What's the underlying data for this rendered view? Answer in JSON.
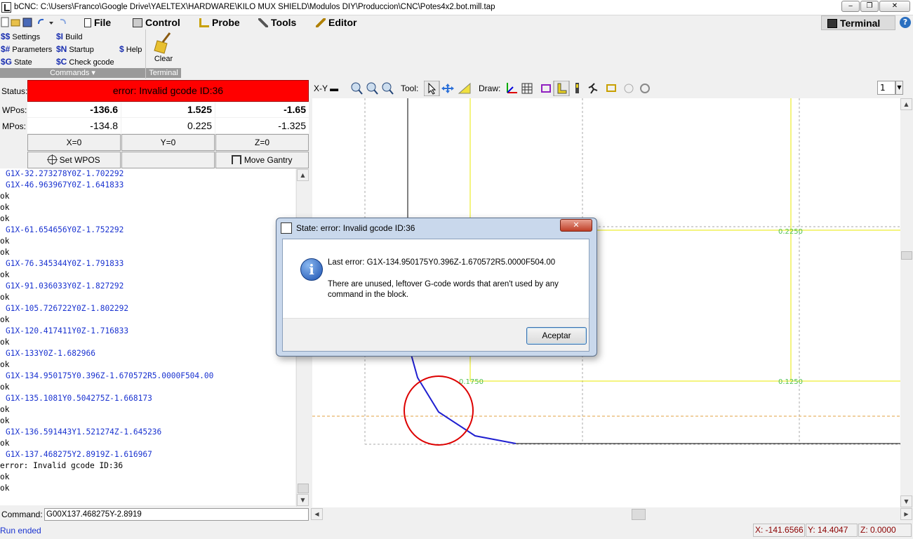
{
  "window": {
    "title": "bCNC: C:\\Users\\Franco\\Google Drive\\YAELTEX\\HARDWARE\\KILO MUX SHIELD\\Modulos DIY\\Produccion\\CNC\\Potes4x2.bot.mill.tap",
    "min": "‒",
    "max": "❐",
    "close": "✕"
  },
  "menu": {
    "file": "File",
    "control": "Control",
    "probe": "Probe",
    "tools": "Tools",
    "editor": "Editor",
    "terminal": "Terminal",
    "help_icon": "?"
  },
  "ribbon": {
    "settings": {
      "sym": "$$",
      "label": "Settings"
    },
    "parameters": {
      "sym": "$#",
      "label": "Parameters"
    },
    "state": {
      "sym": "$G",
      "label": "State"
    },
    "build": {
      "sym": "$I",
      "label": "Build"
    },
    "startup": {
      "sym": "$N",
      "label": "Startup"
    },
    "check_gcode": {
      "sym": "$C",
      "label": "Check gcode"
    },
    "help": {
      "sym": "$",
      "label": "Help"
    },
    "clear": "Clear",
    "group_commands": "Commands",
    "group_terminal": "Terminal"
  },
  "status": {
    "label": "Status:",
    "text": "error: Invalid gcode ID:36",
    "wpos_label": "WPos:",
    "mpos_label": "MPos:",
    "wpos": {
      "x": "-136.6",
      "y": "1.525",
      "z": "-1.65"
    },
    "mpos": {
      "x": "-134.8",
      "y": "0.225",
      "z": "-1.325"
    },
    "zero_x": "X=0",
    "zero_y": "Y=0",
    "zero_z": "Z=0",
    "set_wpos": "Set WPOS",
    "move_gantry": "Move Gantry"
  },
  "terminal_lines": [
    {
      "type": "send",
      "text": "G1X-32.273278Y0Z-1.702292"
    },
    {
      "type": "send",
      "text": "G1X-46.963967Y0Z-1.641833"
    },
    {
      "type": "recv",
      "text": "ok"
    },
    {
      "type": "recv",
      "text": "ok"
    },
    {
      "type": "recv",
      "text": "ok"
    },
    {
      "type": "send",
      "text": "G1X-61.654656Y0Z-1.752292"
    },
    {
      "type": "recv",
      "text": "ok"
    },
    {
      "type": "recv",
      "text": "ok"
    },
    {
      "type": "send",
      "text": "G1X-76.345344Y0Z-1.791833"
    },
    {
      "type": "recv",
      "text": "ok"
    },
    {
      "type": "send",
      "text": "G1X-91.036033Y0Z-1.827292"
    },
    {
      "type": "recv",
      "text": "ok"
    },
    {
      "type": "send",
      "text": "G1X-105.726722Y0Z-1.802292"
    },
    {
      "type": "recv",
      "text": "ok"
    },
    {
      "type": "send",
      "text": "G1X-120.417411Y0Z-1.716833"
    },
    {
      "type": "recv",
      "text": "ok"
    },
    {
      "type": "send",
      "text": "G1X-133Y0Z-1.682966"
    },
    {
      "type": "recv",
      "text": "ok"
    },
    {
      "type": "send",
      "text": "G1X-134.950175Y0.396Z-1.670572R5.0000F504.00"
    },
    {
      "type": "recv",
      "text": "ok"
    },
    {
      "type": "send",
      "text": "G1X-135.1081Y0.504275Z-1.668173"
    },
    {
      "type": "recv",
      "text": "ok"
    },
    {
      "type": "recv",
      "text": "ok"
    },
    {
      "type": "send",
      "text": "G1X-136.591443Y1.521274Z-1.645236"
    },
    {
      "type": "recv",
      "text": "ok"
    },
    {
      "type": "send",
      "text": "G1X-137.468275Y2.8919Z-1.616967"
    },
    {
      "type": "recv",
      "text": "error: Invalid gcode ID:36"
    },
    {
      "type": "recv",
      "text": "ok"
    },
    {
      "type": "recv",
      "text": "ok"
    }
  ],
  "toolbar": {
    "view": "X-Y",
    "tool_label": "Tool:",
    "draw_label": "Draw:",
    "layer_value": "1"
  },
  "canvas": {
    "grid_labels": [
      "0.2250",
      "0.1750",
      "0.1250"
    ]
  },
  "dialog": {
    "title": "State: error: Invalid gcode ID:36",
    "close": "✕",
    "info_icon": "i",
    "last_error": "Last error:  G1X-134.950175Y0.396Z-1.670572R5.0000F504.00",
    "message_line1": "There are unused, leftover G-code words that aren't used by any",
    "message_line2": "command in the block.",
    "ok_button": "Aceptar"
  },
  "command": {
    "label": "Command:",
    "value": "G00X137.468275Y-2.8919"
  },
  "statusbar": {
    "text": "Run ended",
    "x": "X: -141.6566",
    "y": "Y: 14.4047",
    "z": "Z: 0.0000"
  },
  "colors": {
    "error_bg": "#ff0000",
    "gcode_blue": "#1a33d0",
    "path_blue": "#1f1fd0",
    "grid_yellow": "#e8e800",
    "circle_red": "#dd0000",
    "coord_red": "#8b0000"
  }
}
